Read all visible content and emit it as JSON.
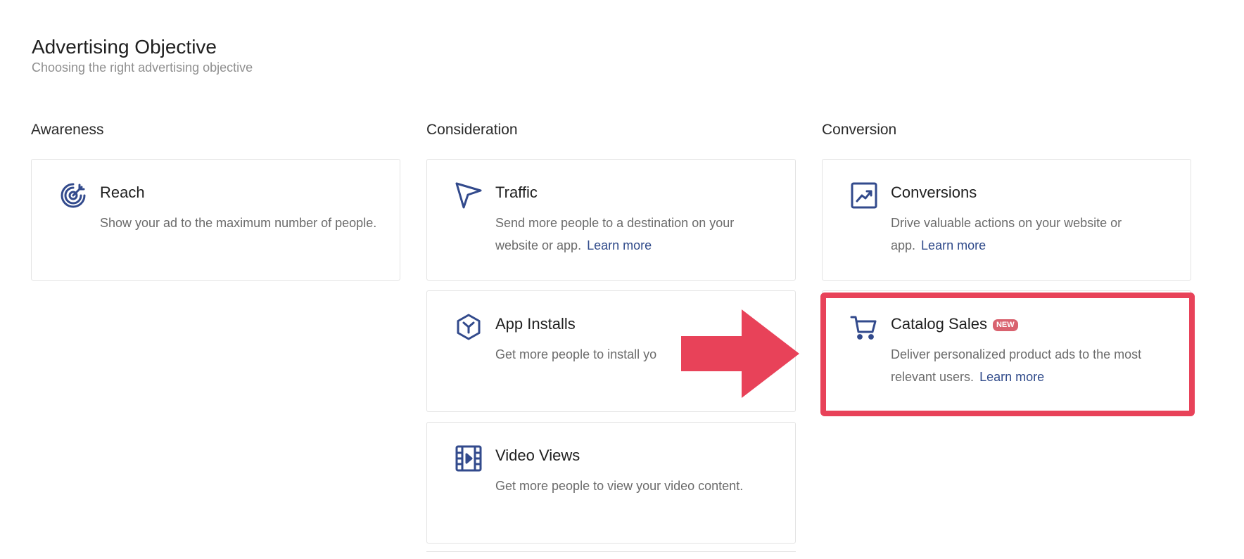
{
  "page": {
    "title": "Advertising Objective",
    "subtitle": "Choosing the right advertising objective"
  },
  "columns": [
    {
      "heading": "Awareness",
      "cards": [
        {
          "icon": "target-icon",
          "title": "Reach",
          "description": "Show your ad to the maximum number of people.",
          "learn_more": ""
        }
      ]
    },
    {
      "heading": "Consideration",
      "cards": [
        {
          "icon": "cursor-arrow-icon",
          "title": "Traffic",
          "description": "Send more people to a destination on your website or app.",
          "learn_more": "Learn more"
        },
        {
          "icon": "app-hexagon-icon",
          "title": "App Installs",
          "description": "Get more people to install yo",
          "learn_more": ""
        },
        {
          "icon": "video-film-icon",
          "title": "Video Views",
          "description": "Get more people to view your video content.",
          "learn_more": ""
        }
      ]
    },
    {
      "heading": "Conversion",
      "cards": [
        {
          "icon": "trend-chart-icon",
          "title": "Conversions",
          "description": "Drive valuable actions on your website or app.",
          "learn_more": "Learn more"
        },
        {
          "icon": "shopping-cart-icon",
          "title": "Catalog Sales",
          "badge": "NEW",
          "description": "Deliver personalized product ads to the most relevant users.",
          "learn_more": "Learn more"
        }
      ]
    }
  ],
  "colors": {
    "accent": "#324a8c",
    "link": "#2f4a8a",
    "highlight": "#e84259",
    "badge": "#d9626f"
  }
}
